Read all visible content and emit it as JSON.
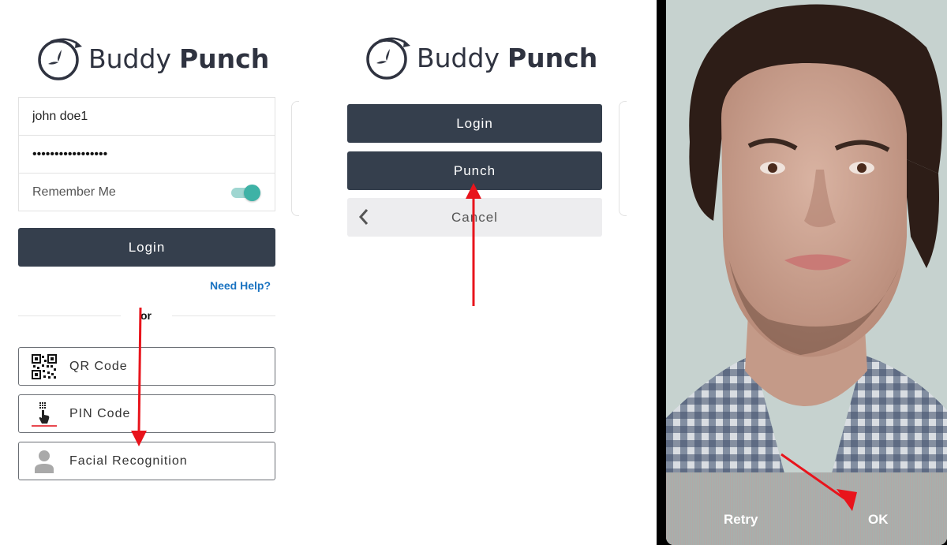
{
  "brand": {
    "name_light": "Buddy",
    "name_bold": "Punch",
    "text_color": "#2f3340"
  },
  "login_screen": {
    "username_value": "john doe1",
    "password_mask": "•••••••••••••••••",
    "remember_me_label": "Remember Me",
    "remember_me_on": true,
    "login_label": "Login",
    "need_help_label": "Need Help?",
    "or_label": "or",
    "methods": [
      {
        "label": "QR Code",
        "icon": "qr-code-icon"
      },
      {
        "label": "PIN Code",
        "icon": "pin-touch-icon"
      },
      {
        "label": "Facial Recognition",
        "icon": "user-silhouette-icon"
      }
    ]
  },
  "action_screen": {
    "login_label": "Login",
    "punch_label": "Punch",
    "cancel_label": "Cancel"
  },
  "camera_screen": {
    "retry_label": "Retry",
    "ok_label": "OK"
  },
  "colors": {
    "button_dark": "#353f4d",
    "toggle_on": "#3eb2a6",
    "link": "#1a73c1",
    "annotation_arrow": "#e8141c"
  }
}
